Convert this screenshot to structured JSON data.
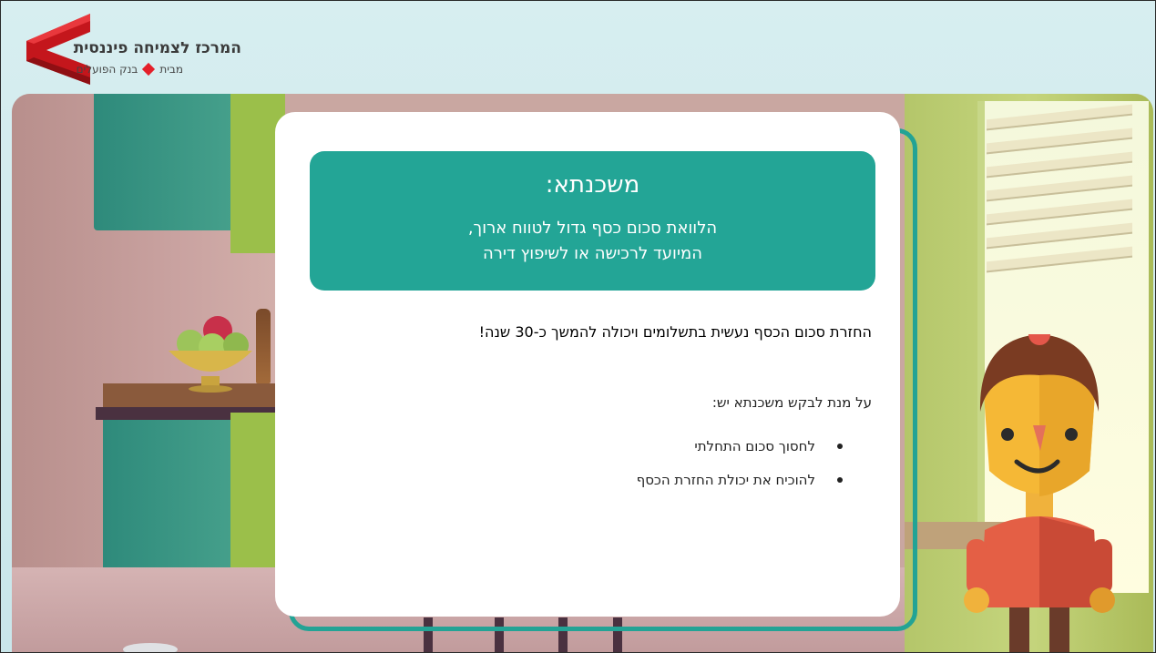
{
  "logo": {
    "title": "המרכז לצמיחה פיננסית",
    "subtitle_a": "מבית",
    "subtitle_b": "בנק הפועלים",
    "brand_color": "#e4202a"
  },
  "card": {
    "title": "משכנתא:",
    "definition_line1": "הלוואת סכום כסף גדול לטווח ארוך,",
    "definition_line2": "המיועד לרכישה או לשיפוץ דירה",
    "statement": "החזרת סכום הכסף נעשית בתשלומים ויכולה להמשך כ-30 שנה!",
    "requirements_intro": "על מנת לבקש משכנתא יש:",
    "requirements": [
      "לחסוך סכום התחלתי",
      "להוכיח את יכולת החזרת הכסף"
    ],
    "accent_color": "#23a596"
  }
}
